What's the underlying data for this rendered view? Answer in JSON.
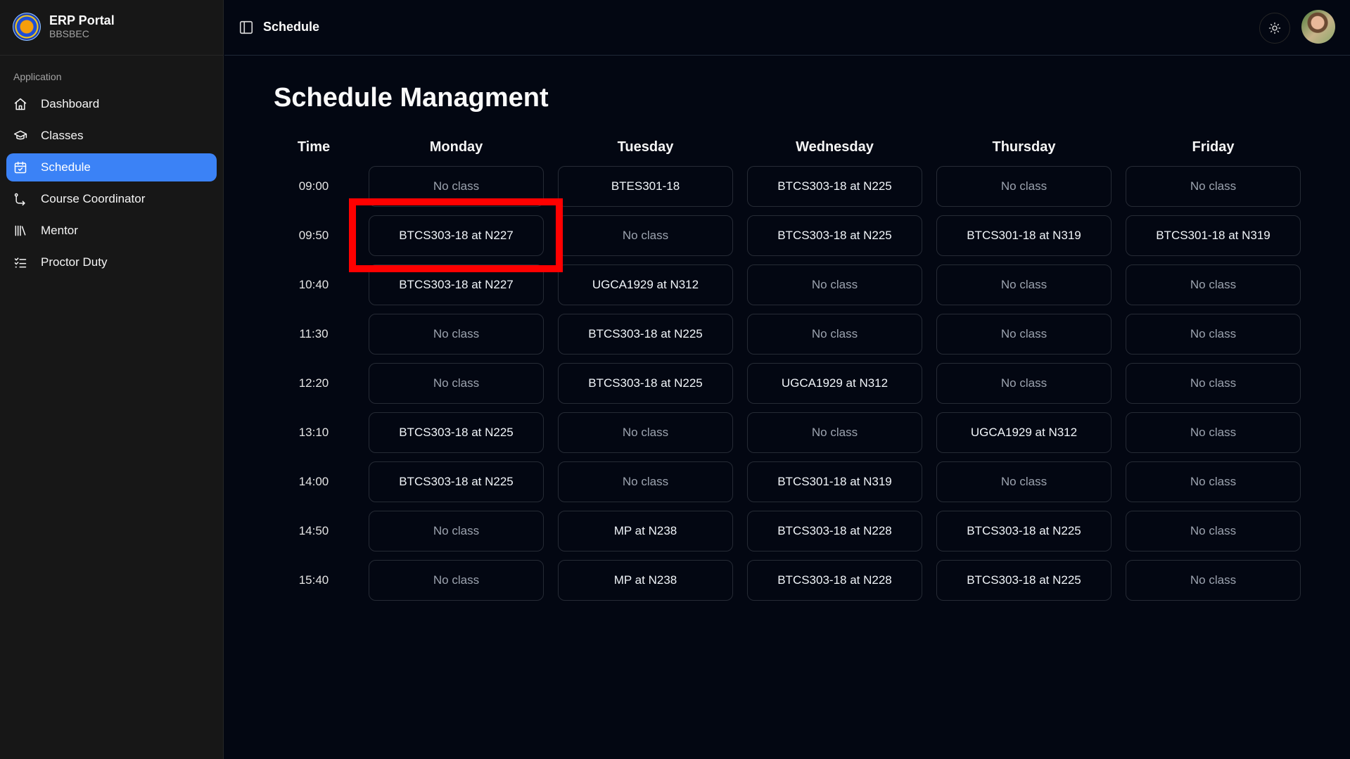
{
  "brand": {
    "title": "ERP Portal",
    "subtitle": "BBSBEC"
  },
  "sidebar": {
    "group_label": "Application",
    "items": [
      {
        "label": "Dashboard",
        "icon": "home-icon",
        "active": false
      },
      {
        "label": "Classes",
        "icon": "graduation-cap-icon",
        "active": false
      },
      {
        "label": "Schedule",
        "icon": "calendar-check-icon",
        "active": true
      },
      {
        "label": "Course Coordinator",
        "icon": "route-icon",
        "active": false
      },
      {
        "label": "Mentor",
        "icon": "library-icon",
        "active": false
      },
      {
        "label": "Proctor Duty",
        "icon": "list-checks-icon",
        "active": false
      }
    ]
  },
  "header": {
    "title": "Schedule",
    "toggle_icon": "sidebar-toggle-icon",
    "theme_icon": "sun-icon"
  },
  "main": {
    "title": "Schedule Managment",
    "time_header": "Time",
    "days": [
      "Monday",
      "Tuesday",
      "Wednesday",
      "Thursday",
      "Friday"
    ],
    "rows": [
      {
        "time": "09:00",
        "cells": [
          "No class",
          "BTES301-18",
          "BTCS303-18 at N225",
          "No class",
          "No class"
        ]
      },
      {
        "time": "09:50",
        "cells": [
          "BTCS303-18 at N227",
          "No class",
          "BTCS303-18 at N225",
          "BTCS301-18 at N319",
          "BTCS301-18 at N319"
        ]
      },
      {
        "time": "10:40",
        "cells": [
          "BTCS303-18 at N227",
          "UGCA1929 at N312",
          "No class",
          "No class",
          "No class"
        ]
      },
      {
        "time": "11:30",
        "cells": [
          "No class",
          "BTCS303-18 at N225",
          "No class",
          "No class",
          "No class"
        ]
      },
      {
        "time": "12:20",
        "cells": [
          "No class",
          "BTCS303-18 at N225",
          "UGCA1929 at N312",
          "No class",
          "No class"
        ]
      },
      {
        "time": "13:10",
        "cells": [
          "BTCS303-18 at N225",
          "No class",
          "No class",
          "UGCA1929 at N312",
          "No class"
        ]
      },
      {
        "time": "14:00",
        "cells": [
          "BTCS303-18 at N225",
          "No class",
          "BTCS301-18 at N319",
          "No class",
          "No class"
        ]
      },
      {
        "time": "14:50",
        "cells": [
          "No class",
          "MP at N238",
          "BTCS303-18 at N228",
          "BTCS303-18 at N225",
          "No class"
        ]
      },
      {
        "time": "15:40",
        "cells": [
          "No class",
          "MP at N238",
          "BTCS303-18 at N228",
          "BTCS303-18 at N225",
          "No class"
        ]
      }
    ]
  },
  "colors": {
    "accent": "#3b82f6",
    "highlight": "#ff0000",
    "background": "#030712",
    "sidebar": "#171717"
  }
}
